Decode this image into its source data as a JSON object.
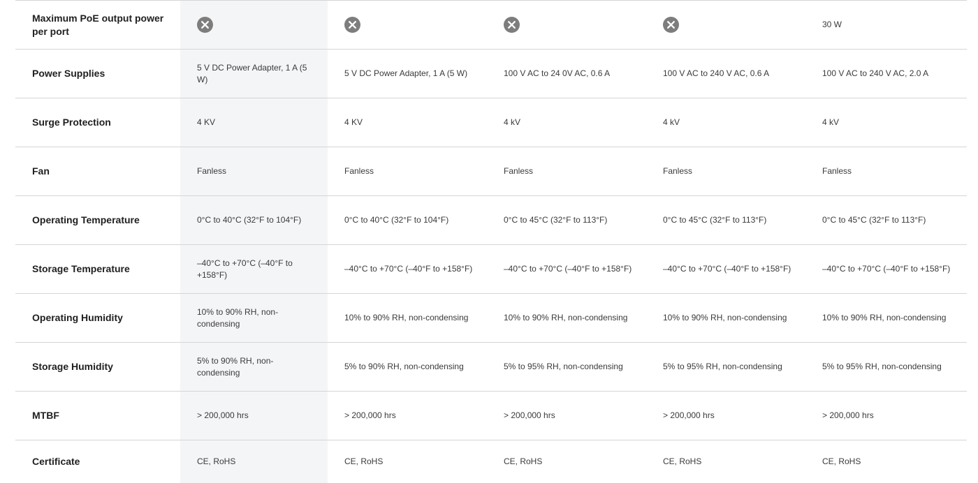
{
  "icons": {
    "not_supported": "close-circle-icon",
    "not_supported_color": "#7d7d7d"
  },
  "rows": [
    {
      "label": "Maximum PoE output power per port",
      "cells": [
        "",
        "",
        "",
        "",
        "30 W"
      ]
    },
    {
      "label": "Power Supplies",
      "cells": [
        "5 V DC Power Adapter, 1 A (5 W)",
        "5 V DC Power Adapter, 1 A (5 W)",
        "100 V AC to 24 0V AC, 0.6 A",
        "100 V AC to 240 V AC, 0.6 A",
        "100 V AC to 240 V AC, 2.0 A"
      ]
    },
    {
      "label": "Surge Protection",
      "cells": [
        "4 KV",
        "4 KV",
        "4 kV",
        "4 kV",
        "4 kV"
      ]
    },
    {
      "label": "Fan",
      "cells": [
        "Fanless",
        "Fanless",
        "Fanless",
        "Fanless",
        "Fanless"
      ]
    },
    {
      "label": "Operating Temperature",
      "cells": [
        "0°C to 40°C (32°F to 104°F)",
        "0°C to 40°C (32°F to 104°F)",
        "0°C to 45°C (32°F to 113°F)",
        "0°C to 45°C (32°F to 113°F)",
        "0°C to 45°C (32°F to 113°F)"
      ]
    },
    {
      "label": "Storage Temperature",
      "cells": [
        "–40°C to +70°C (–40°F to +158°F)",
        "–40°C to +70°C (–40°F to +158°F)",
        "–40°C to +70°C (–40°F to +158°F)",
        "–40°C to +70°C (–40°F to +158°F)",
        "–40°C to +70°C (–40°F to +158°F)"
      ]
    },
    {
      "label": "Operating Humidity",
      "cells": [
        "10% to 90% RH, non-condensing",
        "10% to 90% RH, non-condensing",
        "10% to 90% RH, non-condensing",
        "10% to 90% RH, non-condensing",
        "10% to 90% RH, non-condensing"
      ]
    },
    {
      "label": "Storage Humidity",
      "cells": [
        "5% to 90% RH, non-condensing",
        "5% to 90% RH, non-condensing",
        "5% to 95% RH, non-condensing",
        "5% to 95% RH, non-condensing",
        "5% to 95% RH, non-condensing"
      ]
    },
    {
      "label": "MTBF",
      "cells": [
        "> 200,000 hrs",
        "> 200,000 hrs",
        "> 200,000 hrs",
        "> 200,000 hrs",
        "> 200,000 hrs"
      ]
    },
    {
      "label": "Certificate",
      "cells": [
        "CE, RoHS",
        "CE, RoHS",
        "CE, RoHS",
        "CE, RoHS",
        "CE, RoHS"
      ]
    }
  ]
}
